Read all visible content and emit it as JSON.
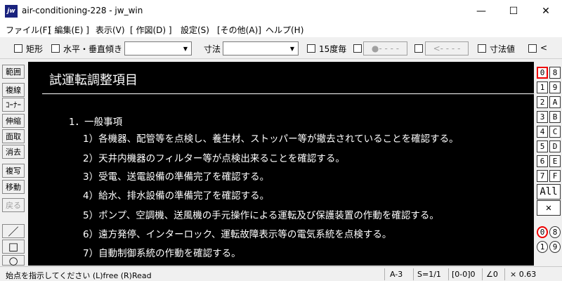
{
  "window": {
    "logo": "jw",
    "title": "air-conditioning-228 - jw_win",
    "minimize": "—",
    "maximize": "☐",
    "close": "✕"
  },
  "menu": [
    "ファイル(F)",
    "[ 編集(E) ]",
    "表示(V)",
    "[ 作図(D) ]",
    "設定(S)",
    "[その他(A)]",
    "ヘルプ(H)"
  ],
  "toolbar": {
    "rect_label": "矩形",
    "hv_label": "水平・垂直",
    "slope_label": "傾き",
    "dim_label": "寸法",
    "deg15_label": "15度毎",
    "btn_dots": "●- - - -",
    "btn_arrow": "<- - - -",
    "dimval_label": "寸法値",
    "lt_label": "<"
  },
  "left_tools": [
    "範囲",
    "複線",
    "ｺｰﾅｰ",
    "伸縮",
    "面取",
    "消去",
    "複写",
    "移動",
    "戻る",
    "／",
    "□",
    "○"
  ],
  "right_layers": {
    "left": [
      "0",
      "1",
      "2",
      "3",
      "4",
      "5",
      "6",
      "7"
    ],
    "right": [
      "8",
      "9",
      "A",
      "B",
      "C",
      "D",
      "E",
      "F"
    ],
    "all_label": "All",
    "cross_label": "✕",
    "group_left": [
      "0",
      "1"
    ],
    "group_right": [
      "8",
      "9"
    ]
  },
  "document": {
    "title": "試運転調整項目",
    "lines": [
      "1．一般事項",
      "1）各機器、配管等を点検し、養生材、ストッパー等が撤去されていることを確認する。",
      "2）天井内機器のフィルター等が点検出来ることを確認する。",
      "3）受電、送電設備の準備完了を確認する。",
      "4）給水、排水設備の準備完了を確認する。",
      "5）ポンプ、空調機、送風機の手元操作による運転及び保護装置の作動を確認する。",
      "6）遠方発停、インターロック、運転故障表示等の電気系統を点検する。",
      "7）自動制御系統の作動を確認する。"
    ]
  },
  "status": {
    "message": "始点を指示してください (L)free (R)Read",
    "paper": "A-3",
    "scale": "S=1/1",
    "layer": "[0-0]0",
    "angle": "∠0",
    "zoom": "× 0.63"
  }
}
